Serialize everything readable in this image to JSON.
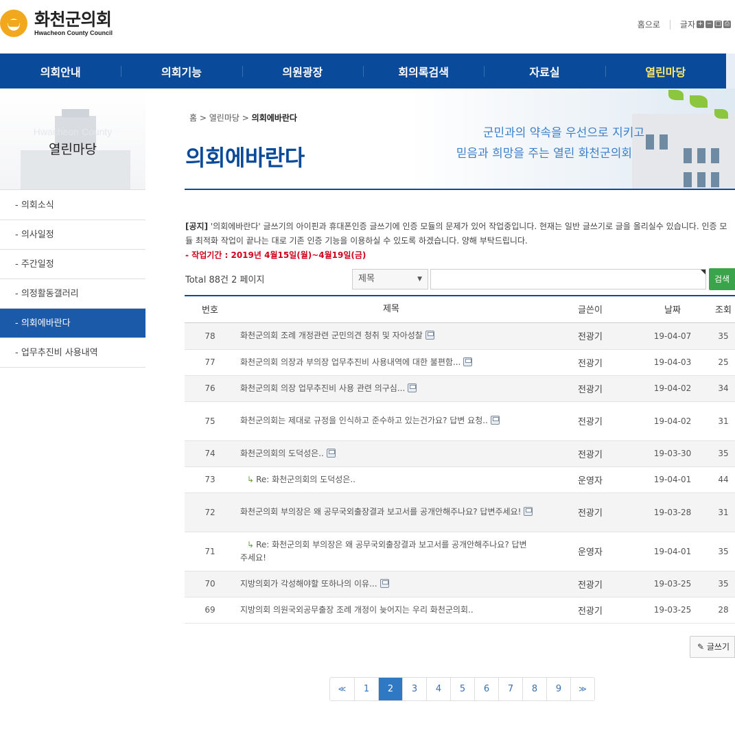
{
  "logo": {
    "name_kr": "화천군의회",
    "name_en": "Hwacheon County Council"
  },
  "util": {
    "home": "홈으로",
    "font_size": "글자",
    "font_buttons": [
      "+",
      "−",
      "□",
      "⎙"
    ]
  },
  "gnb": [
    "의회안내",
    "의회기능",
    "의원광장",
    "회의록검색",
    "자료실",
    "열린마당"
  ],
  "sidebar": {
    "banner_en": "Hwacheon County",
    "title": "열린마당",
    "items": [
      "- 의회소식",
      "- 의사일정",
      "- 주간일정",
      "- 의정활동갤러리",
      "- 의회에바란다",
      "- 업무추진비 사용내역"
    ]
  },
  "visual": {
    "slogan_line1": "군민과의 약속을 우선으로 지키고",
    "slogan_line2": "믿음과 희망을 주는 열린 화천군의회"
  },
  "breadcrumb": {
    "home": "홈",
    "sep": ">",
    "parent": "열린마당",
    "current": "의회에바란다"
  },
  "page_title": "의회에바란다",
  "notice": {
    "tag": "[공지]",
    "text": " '의회에바란다' 글쓰기의 아이핀과 휴대폰인증 글쓰기에 인증 모듈의 문제가 있어 작업중입니다. 현재는 일반 글쓰기로 글을 올리실수 있습니다. 인증 모듈 최적화 작업이 끝나는 대로 기존 인증 기능을 이용하실 수 있도록 하겠습니다. 양해 부탁드립니다.",
    "period": "- 작업기간 : 2019년 4월15일(월)~4월19일(금)"
  },
  "search": {
    "total": "Total 88건 2 페이지",
    "select_value": "제목",
    "input_value": "",
    "button": "검색"
  },
  "table": {
    "headers": [
      "번호",
      "제목",
      "글쓴이",
      "날짜",
      "조회"
    ],
    "rows": [
      {
        "num": "78",
        "title": "화천군의회 조례 개정관련 군민의견 청취 및 자아성찰",
        "file": true,
        "reply": false,
        "writer": "전광기",
        "date": "19-04-07",
        "views": "35"
      },
      {
        "num": "77",
        "title": "화천군의회 의장과 부의장 업무추진비 사용내역에 대한 불편함...",
        "file": true,
        "reply": false,
        "writer": "전광기",
        "date": "19-04-03",
        "views": "25"
      },
      {
        "num": "76",
        "title": "화천군의회 의장 업무추진비 사용 관련 의구심...",
        "file": true,
        "reply": false,
        "writer": "전광기",
        "date": "19-04-02",
        "views": "34"
      },
      {
        "num": "75",
        "title": "화천군의회는 제대로 규정을 인식하고 준수하고 있는건가요? 답변 요청..",
        "file": true,
        "reply": false,
        "writer": "전광기",
        "date": "19-04-02",
        "views": "31"
      },
      {
        "num": "74",
        "title": "화천군의회의 도덕성은..",
        "file": true,
        "reply": false,
        "writer": "전광기",
        "date": "19-03-30",
        "views": "35"
      },
      {
        "num": "73",
        "title": "Re: 화천군의회의 도덕성은..",
        "file": false,
        "reply": true,
        "writer": "운영자",
        "date": "19-04-01",
        "views": "44"
      },
      {
        "num": "72",
        "title": "화천군의회 부의장은 왜 공무국외출장결과 보고서를 공개안해주나요? 답변주세요!",
        "file": true,
        "reply": false,
        "writer": "전광기",
        "date": "19-03-28",
        "views": "31"
      },
      {
        "num": "71",
        "title": "Re: 화천군의회 부의장은 왜 공무국외출장결과 보고서를 공개안해주나요? 답변주세요!",
        "file": false,
        "reply": true,
        "writer": "운영자",
        "date": "19-04-01",
        "views": "35"
      },
      {
        "num": "70",
        "title": "지방의회가 각성해야할 또하나의 이유...",
        "file": true,
        "reply": false,
        "writer": "전광기",
        "date": "19-03-25",
        "views": "35"
      },
      {
        "num": "69",
        "title": "지방의회 의원국외공무출장 조례 개정이 늦어지는 우리 화천군의회..",
        "file": false,
        "reply": false,
        "writer": "전광기",
        "date": "19-03-25",
        "views": "28"
      }
    ]
  },
  "write_button": "글쓰기",
  "paging": {
    "prev": "≪",
    "next": "≫",
    "pages": [
      "1",
      "2",
      "3",
      "4",
      "5",
      "6",
      "7",
      "8",
      "9"
    ],
    "current": "2"
  },
  "colors": {
    "primary": "#0a4a9b",
    "active_menu_text": "#ffe86a",
    "search_button": "#3aa44a",
    "notice_period": "#d0021b",
    "page_active": "#2f78c4"
  }
}
